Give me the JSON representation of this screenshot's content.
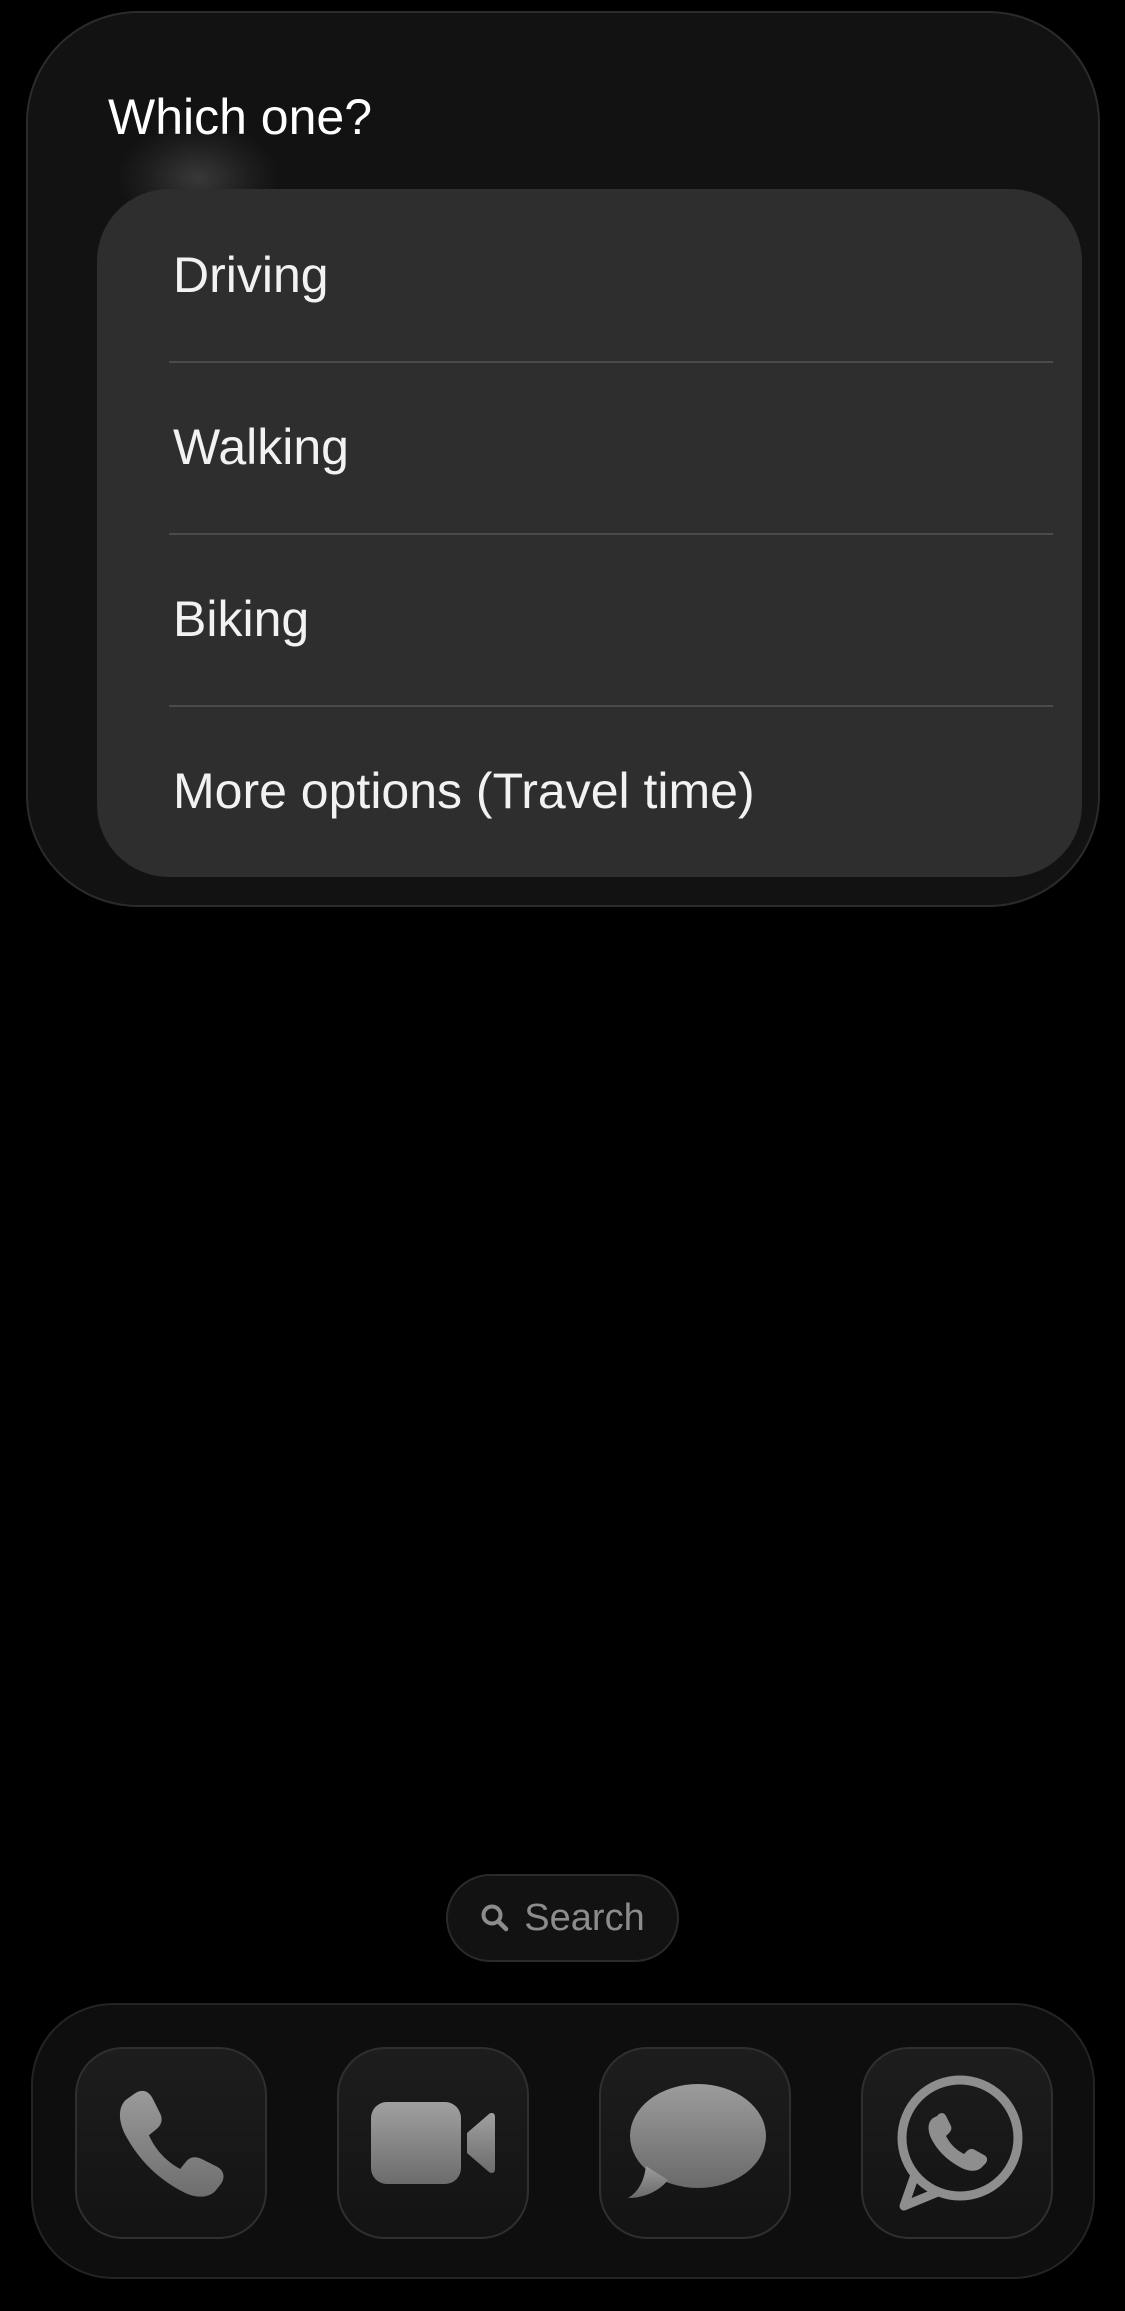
{
  "prompt": {
    "title": "Which one?"
  },
  "options": [
    {
      "label": "Driving"
    },
    {
      "label": "Walking"
    },
    {
      "label": "Biking"
    },
    {
      "label": "More options (Travel time)"
    }
  ],
  "search": {
    "icon": "magnifier-icon",
    "label": "Search"
  },
  "dock": {
    "apps": [
      {
        "icon": "phone-icon"
      },
      {
        "icon": "video-camera-icon"
      },
      {
        "icon": "messages-bubble-icon"
      },
      {
        "icon": "whatsapp-icon"
      }
    ]
  },
  "colors": {
    "background": "#000000",
    "panel": "#121212",
    "options_card": "#2e2e2e",
    "text": "#ffffff",
    "muted_text": "#8c8c8c",
    "icon_gray": "#8a8a8a"
  }
}
